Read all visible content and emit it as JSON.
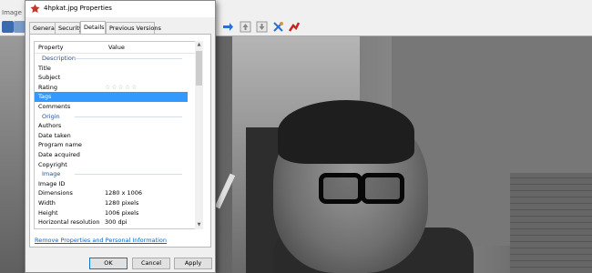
{
  "viewer": {
    "menu_label": "Image"
  },
  "dialog": {
    "title": "4hpkat.jpg Properties",
    "tabs": [
      {
        "label": "General"
      },
      {
        "label": "Security"
      },
      {
        "label": "Details"
      },
      {
        "label": "Previous Versions"
      }
    ],
    "active_tab": "Details",
    "columns": {
      "property": "Property",
      "value": "Value"
    },
    "rows": [
      {
        "type": "section",
        "label": "Description"
      },
      {
        "type": "item",
        "label": "Title",
        "value": ""
      },
      {
        "type": "item",
        "label": "Subject",
        "value": ""
      },
      {
        "type": "item",
        "label": "Rating",
        "value": "☆☆☆☆☆"
      },
      {
        "type": "item",
        "label": "Tags",
        "value": "",
        "selected": true
      },
      {
        "type": "item",
        "label": "Comments",
        "value": ""
      },
      {
        "type": "section",
        "label": "Origin"
      },
      {
        "type": "item",
        "label": "Authors",
        "value": ""
      },
      {
        "type": "item",
        "label": "Date taken",
        "value": ""
      },
      {
        "type": "item",
        "label": "Program name",
        "value": ""
      },
      {
        "type": "item",
        "label": "Date acquired",
        "value": ""
      },
      {
        "type": "item",
        "label": "Copyright",
        "value": ""
      },
      {
        "type": "section",
        "label": "Image"
      },
      {
        "type": "item",
        "label": "Image ID",
        "value": ""
      },
      {
        "type": "item",
        "label": "Dimensions",
        "value": "1280 x 1006"
      },
      {
        "type": "item",
        "label": "Width",
        "value": "1280 pixels"
      },
      {
        "type": "item",
        "label": "Height",
        "value": "1006 pixels"
      },
      {
        "type": "item",
        "label": "Horizontal resolution",
        "value": "300 dpi"
      }
    ],
    "remove_link": "Remove Properties and Personal Information",
    "buttons": {
      "ok": "OK",
      "cancel": "Cancel",
      "apply": "Apply"
    },
    "selection_color": "#3399ff",
    "link_color": "#0066cc"
  }
}
